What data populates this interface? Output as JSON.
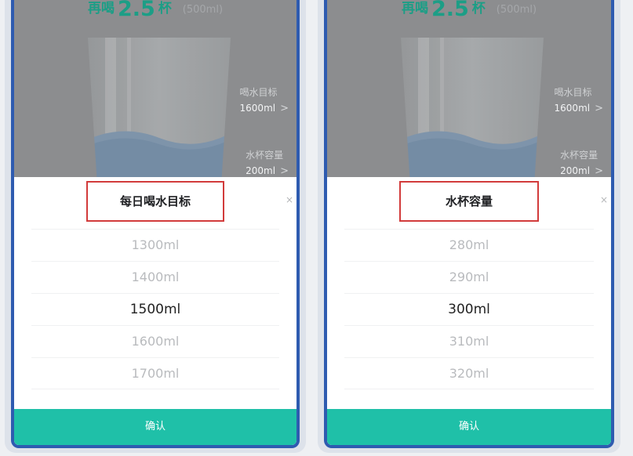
{
  "screens": [
    {
      "remaining": {
        "prefix": "再喝",
        "count": "2.5",
        "unit": "杯",
        "volume": "(500ml)"
      },
      "settings": [
        {
          "label": "喝水目标",
          "value": "1600ml",
          "chevron": ">"
        },
        {
          "label": "水杯容量",
          "value": "200ml",
          "chevron": ">"
        }
      ],
      "sheet": {
        "title": "每日喝水目标",
        "close": "×",
        "options": [
          "1300ml",
          "1400ml",
          "1500ml",
          "1600ml",
          "1700ml"
        ],
        "selected_index": 2,
        "confirm_label": "确认"
      }
    },
    {
      "remaining": {
        "prefix": "再喝",
        "count": "2.5",
        "unit": "杯",
        "volume": "(500ml)"
      },
      "settings": [
        {
          "label": "喝水目标",
          "value": "1600ml",
          "chevron": ">"
        },
        {
          "label": "水杯容量",
          "value": "200ml",
          "chevron": ">"
        }
      ],
      "sheet": {
        "title": "水杯容量",
        "close": "×",
        "options": [
          "280ml",
          "290ml",
          "300ml",
          "310ml",
          "320ml"
        ],
        "selected_index": 2,
        "confirm_label": "确认"
      }
    }
  ],
  "colors": {
    "accent": "#1fc0a8",
    "accent_text": "#1c9e86",
    "highlight_box": "#d23b3b",
    "frame": "#2e5bb0"
  }
}
